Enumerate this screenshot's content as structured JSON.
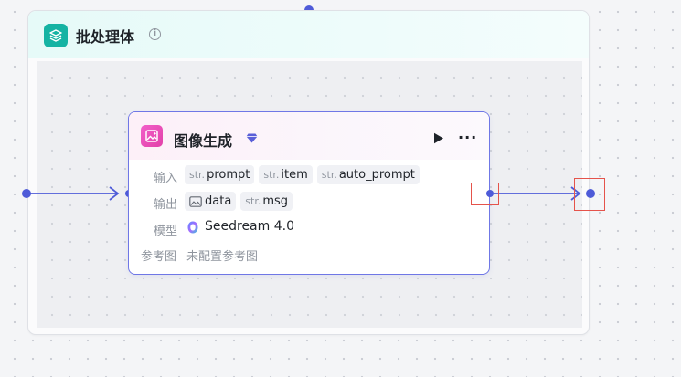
{
  "batch": {
    "title": "批处理体",
    "icon": "layers-icon",
    "accent": "#15b3a3"
  },
  "node": {
    "title": "图像生成",
    "icon": "image-generate-icon",
    "accent": "#e240a8",
    "border_color": "#6f77e6",
    "input_label": "输入",
    "inputs": [
      {
        "type": "str.",
        "name": "prompt"
      },
      {
        "type": "str.",
        "name": "item"
      },
      {
        "type": "str.",
        "name": "auto_prompt"
      }
    ],
    "output_label": "输出",
    "outputs": [
      {
        "type": "image-icon",
        "name": "data"
      },
      {
        "type": "str.",
        "name": "msg"
      }
    ],
    "model_label": "模型",
    "model_value": "Seedream 4.0",
    "ref_label": "参考图",
    "ref_value": "未配置参考图"
  },
  "colors": {
    "edge": "#4e5bd8",
    "highlight": "#e5534b"
  }
}
